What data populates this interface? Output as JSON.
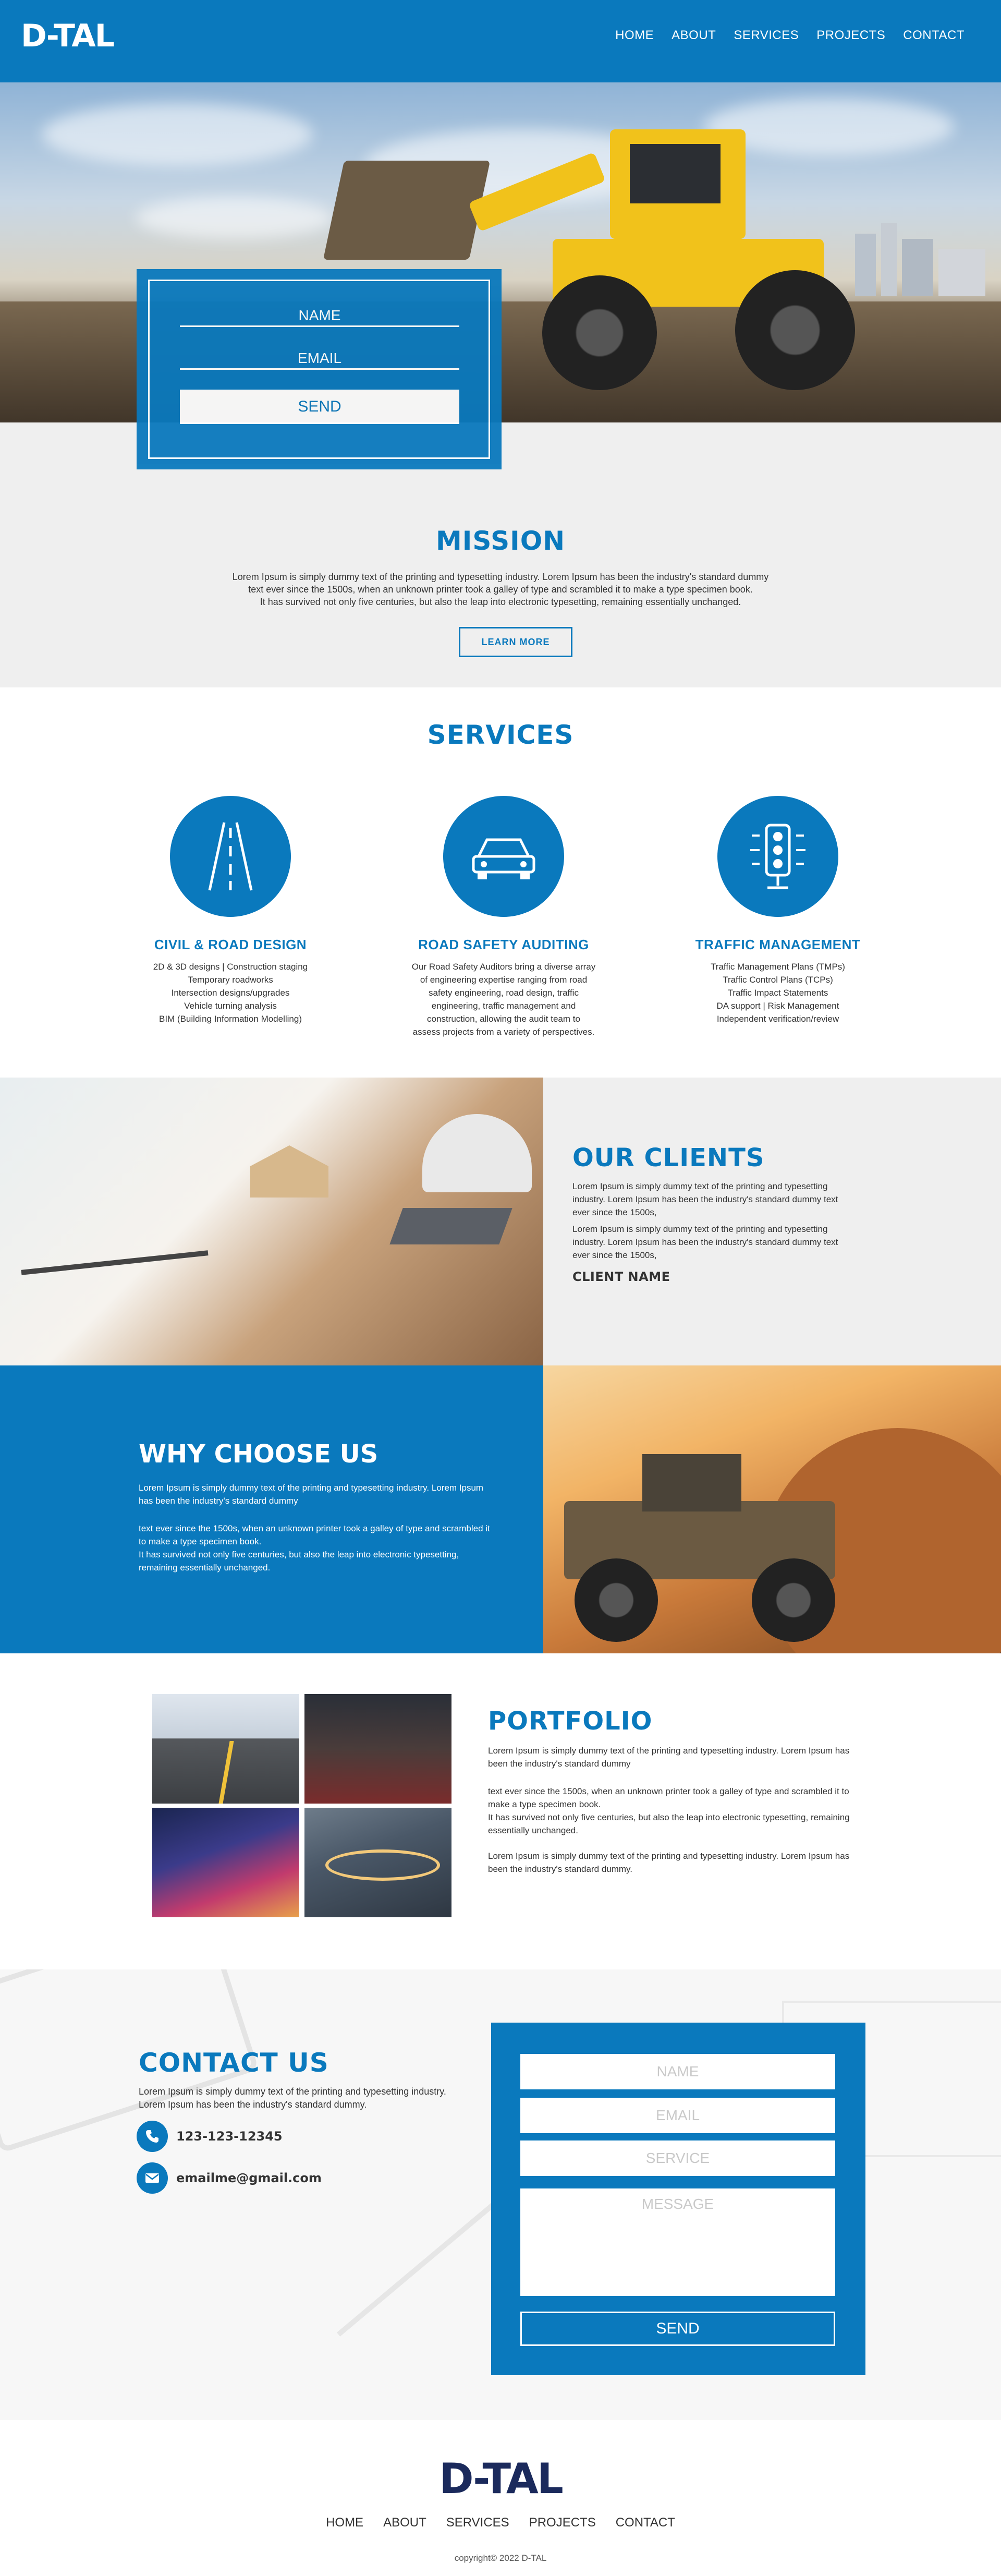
{
  "brand": {
    "logo": "D-TAL",
    "accent": "#0a79bd",
    "footer_logo_color": "#1b2a5c"
  },
  "nav": {
    "items": [
      "HOME",
      "ABOUT",
      "SERVICES",
      "PROJECTS",
      "CONTACT"
    ]
  },
  "hero_form": {
    "name": "NAME",
    "email": "EMAIL",
    "send": "SEND"
  },
  "mission": {
    "title": "MISSION",
    "text_1": "Lorem Ipsum is simply dummy text of the printing and typesetting industry. Lorem Ipsum has been the industry's standard dummy",
    "text_2": "text ever since the 1500s, when an unknown printer took a galley of type and scrambled it to make a type specimen book.",
    "text_3": "It has survived not only five centuries, but also the leap into electronic typesetting, remaining essentially unchanged.",
    "button": "LEARN MORE"
  },
  "services": {
    "title": "SERVICES",
    "items": [
      {
        "icon": "road-icon",
        "title": "CIVIL & ROAD DESIGN",
        "lines": [
          "2D & 3D designs | Construction staging",
          "Temporary roadworks",
          "Intersection designs/upgrades",
          "Vehicle turning analysis",
          "BIM (Building Information Modelling)"
        ]
      },
      {
        "icon": "car-icon",
        "title": "ROAD SAFETY AUDITING",
        "lines": [
          "Our Road Safety Auditors bring a diverse array",
          "of engineering expertise ranging from road",
          "safety engineering, road design, traffic",
          "engineering, traffic management and",
          "construction, allowing the audit team to",
          "assess projects from a variety of perspectives."
        ]
      },
      {
        "icon": "traffic-light-icon",
        "title": "TRAFFIC MANAGEMENT",
        "lines": [
          "Traffic Management Plans (TMPs)",
          "Traffic Control Plans (TCPs)",
          "Traffic Impact Statements",
          "DA support | Risk Management",
          "Independent verification/review"
        ]
      }
    ]
  },
  "clients": {
    "title": "OUR CLIENTS",
    "para_1": "Lorem Ipsum is simply dummy text of the printing and typesetting industry. Lorem Ipsum has been the industry's standard dummy text ever since the 1500s,",
    "para_2": "Lorem Ipsum is simply dummy text of the printing and typesetting industry. Lorem Ipsum has been the industry's standard dummy text ever since the 1500s,",
    "client_name": "CLIENT NAME"
  },
  "why": {
    "title": "WHY CHOOSE US",
    "para_1": "Lorem Ipsum is simply dummy text of the printing and typesetting industry. Lorem Ipsum has been the industry's standard dummy",
    "para_2": "text ever since the 1500s, when an unknown printer took a galley of type and scrambled it to make a type specimen book.",
    "para_3": "It has survived not only five centuries, but also the leap into electronic typesetting, remaining essentially unchanged."
  },
  "portfolio": {
    "title": "PORTFOLIO",
    "para_1": "Lorem Ipsum is simply dummy text of the printing and typesetting industry. Lorem Ipsum has been the industry's standard dummy",
    "para_2": "text ever since the 1500s, when an unknown printer took a galley of type and scrambled it to make a type specimen book.",
    "para_3": "It has survived not only five centuries, but also the leap into electronic typesetting, remaining essentially unchanged.",
    "para_4": "Lorem Ipsum is simply dummy text of the printing and typesetting industry. Lorem Ipsum has been the industry's standard dummy."
  },
  "contact": {
    "title": "CONTACT US",
    "text": "Lorem Ipsum is simply dummy text of the printing and typesetting industry. Lorem Ipsum has been the industry's standard dummy.",
    "phone": "123-123-12345",
    "email": "emailme@gmail.com",
    "form": {
      "name": "NAME",
      "email": "EMAIL",
      "service": "SERVICE",
      "message": "MESSAGE",
      "send": "SEND"
    }
  },
  "footer": {
    "logo": "D-TAL",
    "nav": [
      "HOME",
      "ABOUT",
      "SERVICES",
      "PROJECTS",
      "CONTACT"
    ],
    "copyright": "copyright© 2022 D-TAL"
  }
}
